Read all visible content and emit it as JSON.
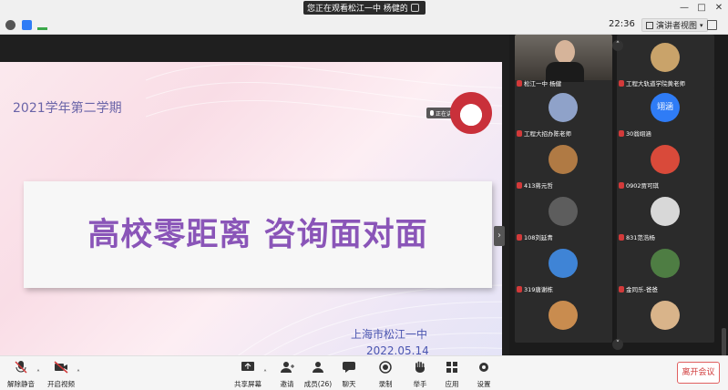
{
  "titlebar": {
    "share_text": "您正在观看松江一中 杨健的屏幕"
  },
  "toprow": {
    "time": "22:36",
    "view_label": "演讲者视图"
  },
  "slide": {
    "semester": "2021学年第二学期",
    "title": "高校零距离 咨询面对面",
    "school": "上海市松江一中",
    "date": "2022.05.14",
    "speaking_tag": "正在讲话"
  },
  "gallery": {
    "tiles": [
      {
        "label": "松江一中 杨健",
        "avatar_color": "#6f6a63"
      },
      {
        "label": "工程大轨道学院黄老师",
        "avatar_color": "#c9a36a"
      },
      {
        "label": "工程大招办陈老师",
        "avatar_color": "#8fa2c9"
      },
      {
        "label": "30翁翊涵",
        "avatar_text": "翊涵",
        "avatar_color": "#2f7cf6"
      },
      {
        "label": "413蒋元哲",
        "avatar_color": "#b07a44"
      },
      {
        "label": "0902贾可琪",
        "avatar_color": "#d94a3a"
      },
      {
        "label": "108刘延青",
        "avatar_color": "#5d5d5d"
      },
      {
        "label": "831范浩杨",
        "avatar_color": "#d8d8d8"
      },
      {
        "label": "319唐谢栋",
        "avatar_color": "#3f84d6"
      },
      {
        "label": "金同乐-爸爸",
        "avatar_color": "#4e7d43"
      },
      {
        "label": "",
        "avatar_color": "#c98c4f"
      },
      {
        "label": "",
        "avatar_color": "#d9b48a"
      }
    ]
  },
  "bottombar": {
    "mute": "解除静音",
    "video": "开启视频",
    "share": "共享屏幕",
    "invite": "邀请",
    "members": "成员(26)",
    "chat": "聊天",
    "record": "录制",
    "raise_hand": "举手",
    "apps": "应用",
    "settings": "设置",
    "leave": "离开会议"
  },
  "colors": {
    "slide_title": "#8a55b8",
    "slide_text": "#4a55b0",
    "leave": "#d03a3a"
  }
}
